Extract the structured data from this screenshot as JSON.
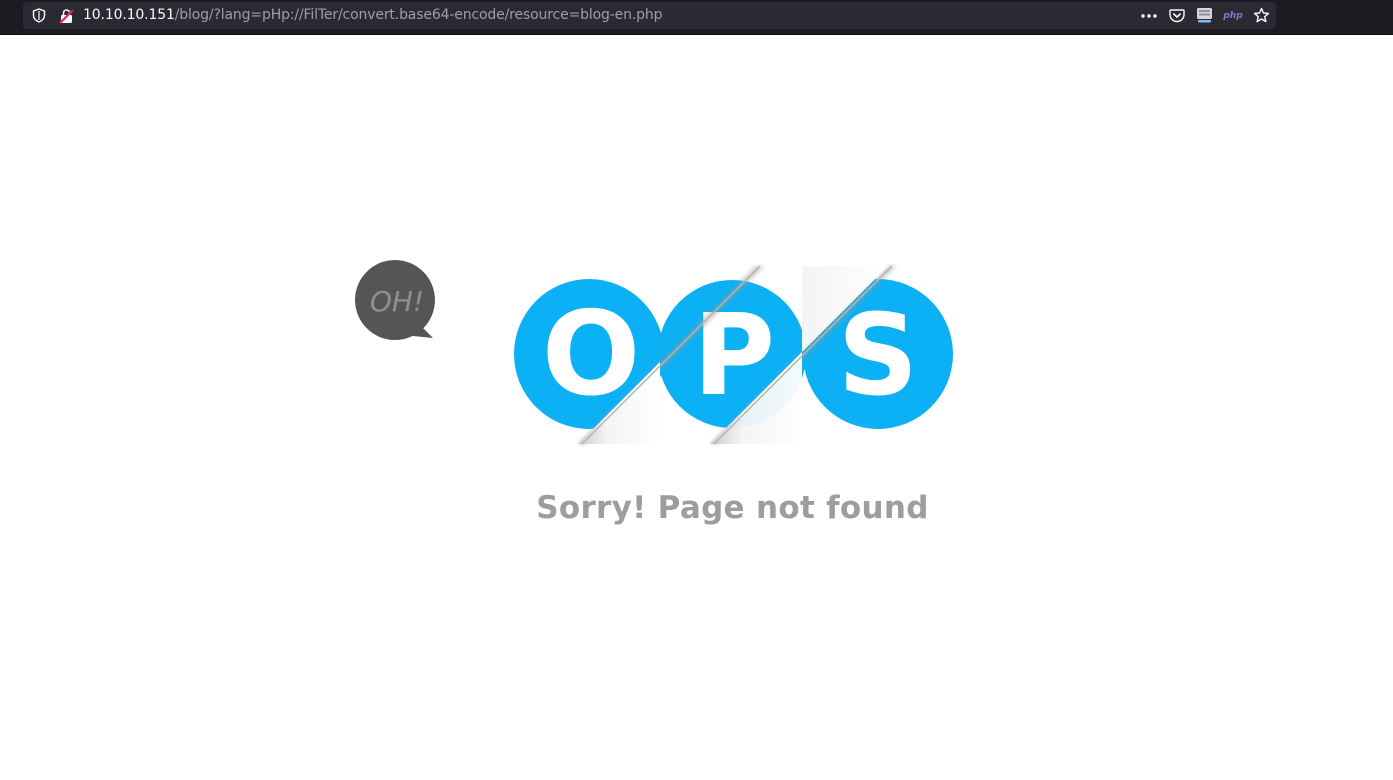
{
  "browser": {
    "url_host": "10.10.10.151",
    "url_path": "/blog/?lang=pHp://FilTer/convert.base64-encode/resource=blog-en.php",
    "php_badge": "php",
    "icons": [
      "shield-icon",
      "insecure-lock-icon",
      "more-actions-icon",
      "pocket-icon",
      "reader-view-icon",
      "php-extension-icon",
      "bookmark-star-icon"
    ]
  },
  "page": {
    "bubble_text": "OH!",
    "logo_letters": [
      "O",
      "P",
      "S"
    ],
    "message": "Sorry! Page not found",
    "colors": {
      "logo_blue": "#0bb0f5",
      "bubble_gray": "#555555",
      "message_gray": "#9d9d9d"
    }
  }
}
